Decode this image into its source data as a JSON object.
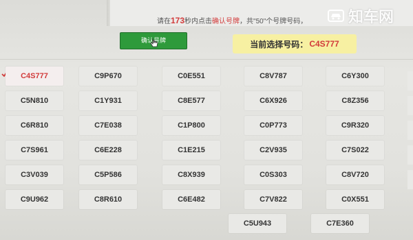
{
  "header": {
    "instruction_prefix": "请在",
    "seconds": "173",
    "instruction_mid": "秒内点击",
    "confirm_word": "确认号牌",
    "instruction_suffix": "，共\"50\"个号牌号码，"
  },
  "watermark": "知车网",
  "confirm_button": {
    "label": "确认号牌"
  },
  "current_selection": {
    "label": "当前选择号码：",
    "value": "C4S777"
  },
  "colors": {
    "accent": "#d23b3b",
    "button": "#2e9a3b",
    "highlight": "#f7f0a2"
  },
  "plates": [
    [
      "C4S777",
      "C9P670",
      "C0E551",
      "C8V787",
      "C6Y300"
    ],
    [
      "C5N810",
      "C1Y931",
      "C8E577",
      "C6X926",
      "C8Z356"
    ],
    [
      "C6R810",
      "C7E038",
      "C1P800",
      "C0P773",
      "C9R320"
    ],
    [
      "C7S961",
      "C6E228",
      "C1E215",
      "C2V935",
      "C7S022"
    ],
    [
      "C3V039",
      "C5P586",
      "C8X939",
      "C0S303",
      "C8V720"
    ],
    [
      "C9U962",
      "C8R610",
      "C6E482",
      "C7V822",
      "C0X551"
    ],
    [
      "C5U943",
      "C7E360"
    ]
  ],
  "selected_plate": "C4S777"
}
